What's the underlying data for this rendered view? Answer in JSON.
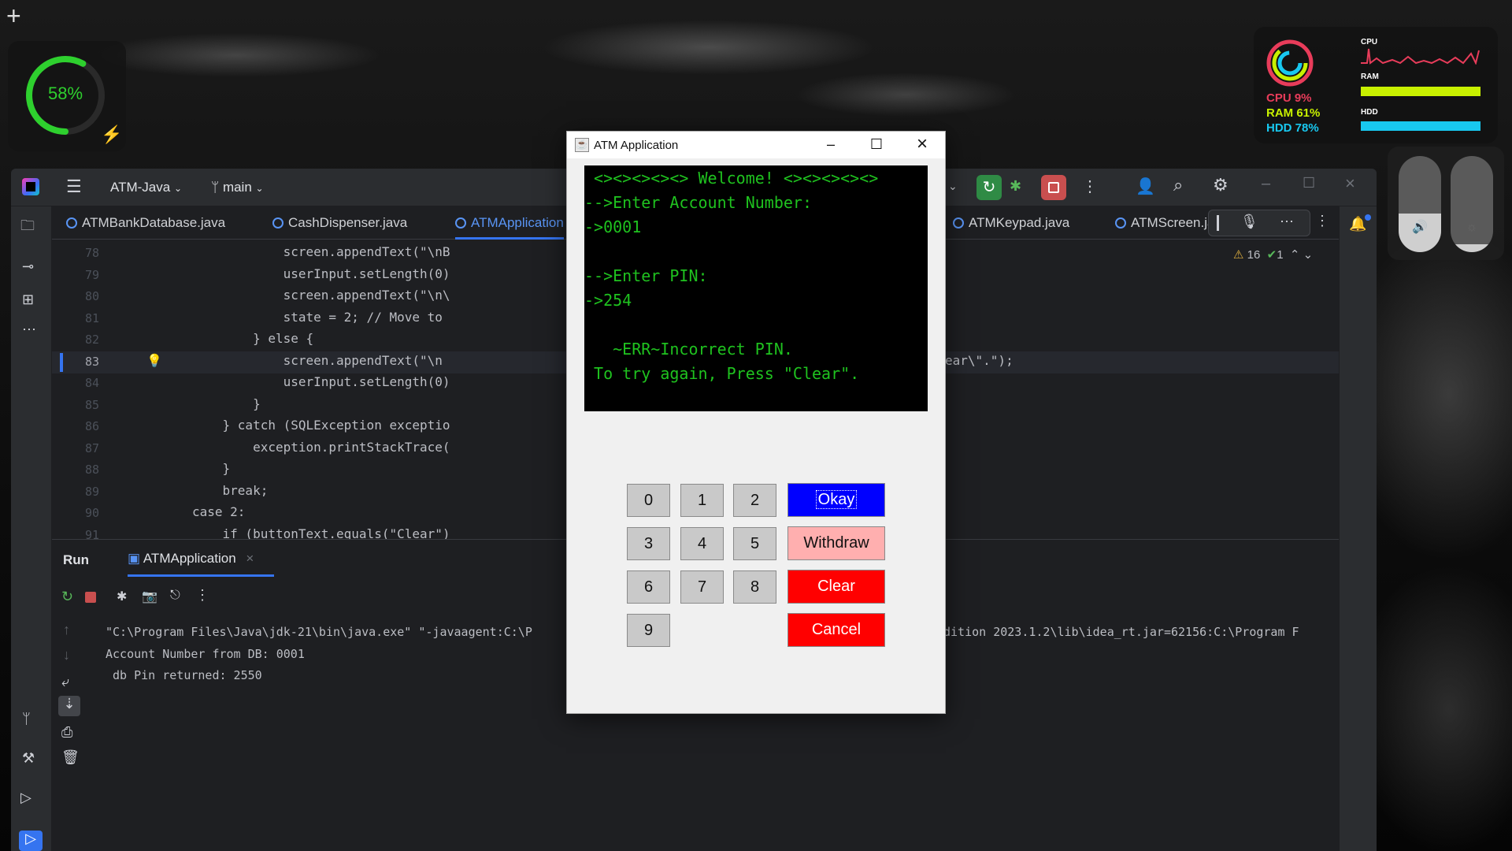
{
  "desktop": {
    "battery": {
      "percent": "58%",
      "level": 0.58
    },
    "sysmon": {
      "cpu_label": "CPU",
      "ram_label": "RAM",
      "hdd_label": "HDD",
      "cpu": "CPU 9%",
      "ram": "RAM 61%",
      "hdd": "HDD 78%",
      "cpu_color": "#e83c5a",
      "ram_color": "#c8f000",
      "hdd_color": "#18c8f0"
    },
    "sliders": {
      "volume_level": 0.4,
      "brightness_level": 0.08
    }
  },
  "ide": {
    "project": "ATM-Java",
    "branch": "main",
    "tabs": [
      "ATMBankDatabase.java",
      "CashDispenser.java",
      "ATMApplication",
      "ATMKeypad.java",
      "ATMScreen.ja"
    ],
    "inspections": {
      "warnings": "16",
      "ok": "1"
    },
    "line_numbers": [
      "78",
      "79",
      "80",
      "81",
      "82",
      "83",
      "84",
      "85",
      "86",
      "87",
      "88",
      "89",
      "90",
      "91"
    ],
    "code_left": [
      "            screen.appendText(\"\\nB",
      "            userInput.setLength(0)",
      "            screen.appendText(\"\\n\\",
      "            state = 2; // Move to",
      "        } else {",
      "            screen.appendText(\"\\n",
      "            userInput.setLength(0)",
      "        }",
      "    } catch (SQLException exceptio",
      "        exception.printStackTrace(",
      "    }",
      "    break;",
      "case 2:",
      "    if (buttonText.equals(\"Clear\")"
    ],
    "code_right_83": "ear\\\".\");",
    "run": {
      "title": "Run",
      "config": "ATMApplication",
      "output": [
        "\"C:\\Program Files\\Java\\jdk-21\\bin\\java.exe\" \"-javaagent:C:\\P",
        "Account Number from DB: 0001",
        " db Pin returned: 2550"
      ],
      "output_right": "dition 2023.1.2\\lib\\idea_rt.jar=62156:C:\\Program F"
    }
  },
  "atm": {
    "title": "ATM Application",
    "screen_lines": [
      " <><><><><> Welcome! <><><><><>",
      "-->Enter Account Number:",
      "->0001",
      "",
      "-->Enter PIN:",
      "->254",
      "",
      "   ~ERR~Incorrect PIN.",
      " To try again, Press \"Clear\"."
    ],
    "keys": [
      "0",
      "1",
      "2",
      "3",
      "4",
      "5",
      "6",
      "7",
      "8",
      "9"
    ],
    "actions": {
      "okay": "Okay",
      "withdraw": "Withdraw",
      "clear": "Clear",
      "cancel": "Cancel"
    },
    "colors": {
      "okay": "#0000ff",
      "withdraw": "#ffafaf",
      "clear": "#ff0000",
      "cancel": "#ff0000",
      "screen_text": "#1fc21f"
    }
  }
}
